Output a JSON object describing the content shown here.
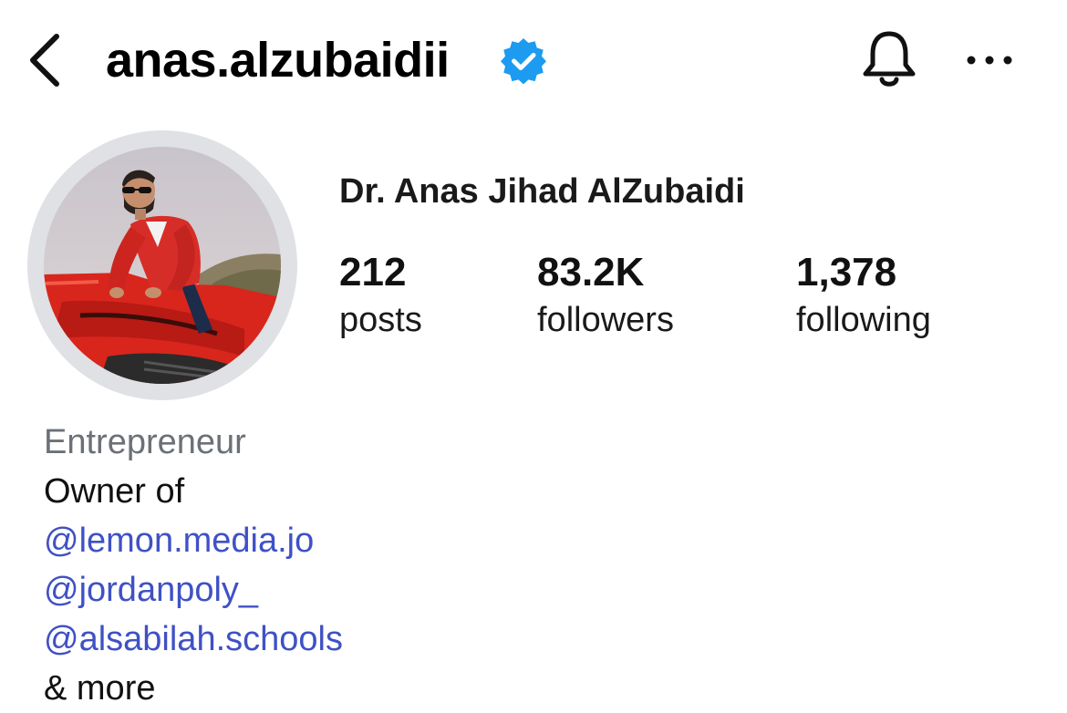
{
  "header": {
    "username": "anas.alzubaidii",
    "verified": true,
    "icons": {
      "back": "chevron-left-icon",
      "verified": "verified-badge-icon",
      "notifications": "bell-icon",
      "more": "more-horizontal-icon"
    }
  },
  "profile": {
    "display_name": "Dr. Anas Jihad AlZubaidi",
    "stats": [
      {
        "value": "212",
        "label": "posts"
      },
      {
        "value": "83.2K",
        "label": "followers"
      },
      {
        "value": "1,378",
        "label": "following"
      }
    ]
  },
  "bio": {
    "category": "Entrepreneur",
    "line": "Owner of",
    "mentions": [
      "@lemon.media.jo",
      "@jordanpoly_",
      "@alsabilah.schools"
    ],
    "more": "& more"
  },
  "colors": {
    "verified_blue": "#1d9bf0",
    "mention_link": "#3f51c5",
    "category_gray": "#6c7077",
    "avatar_ring": "#dfe1e5"
  }
}
